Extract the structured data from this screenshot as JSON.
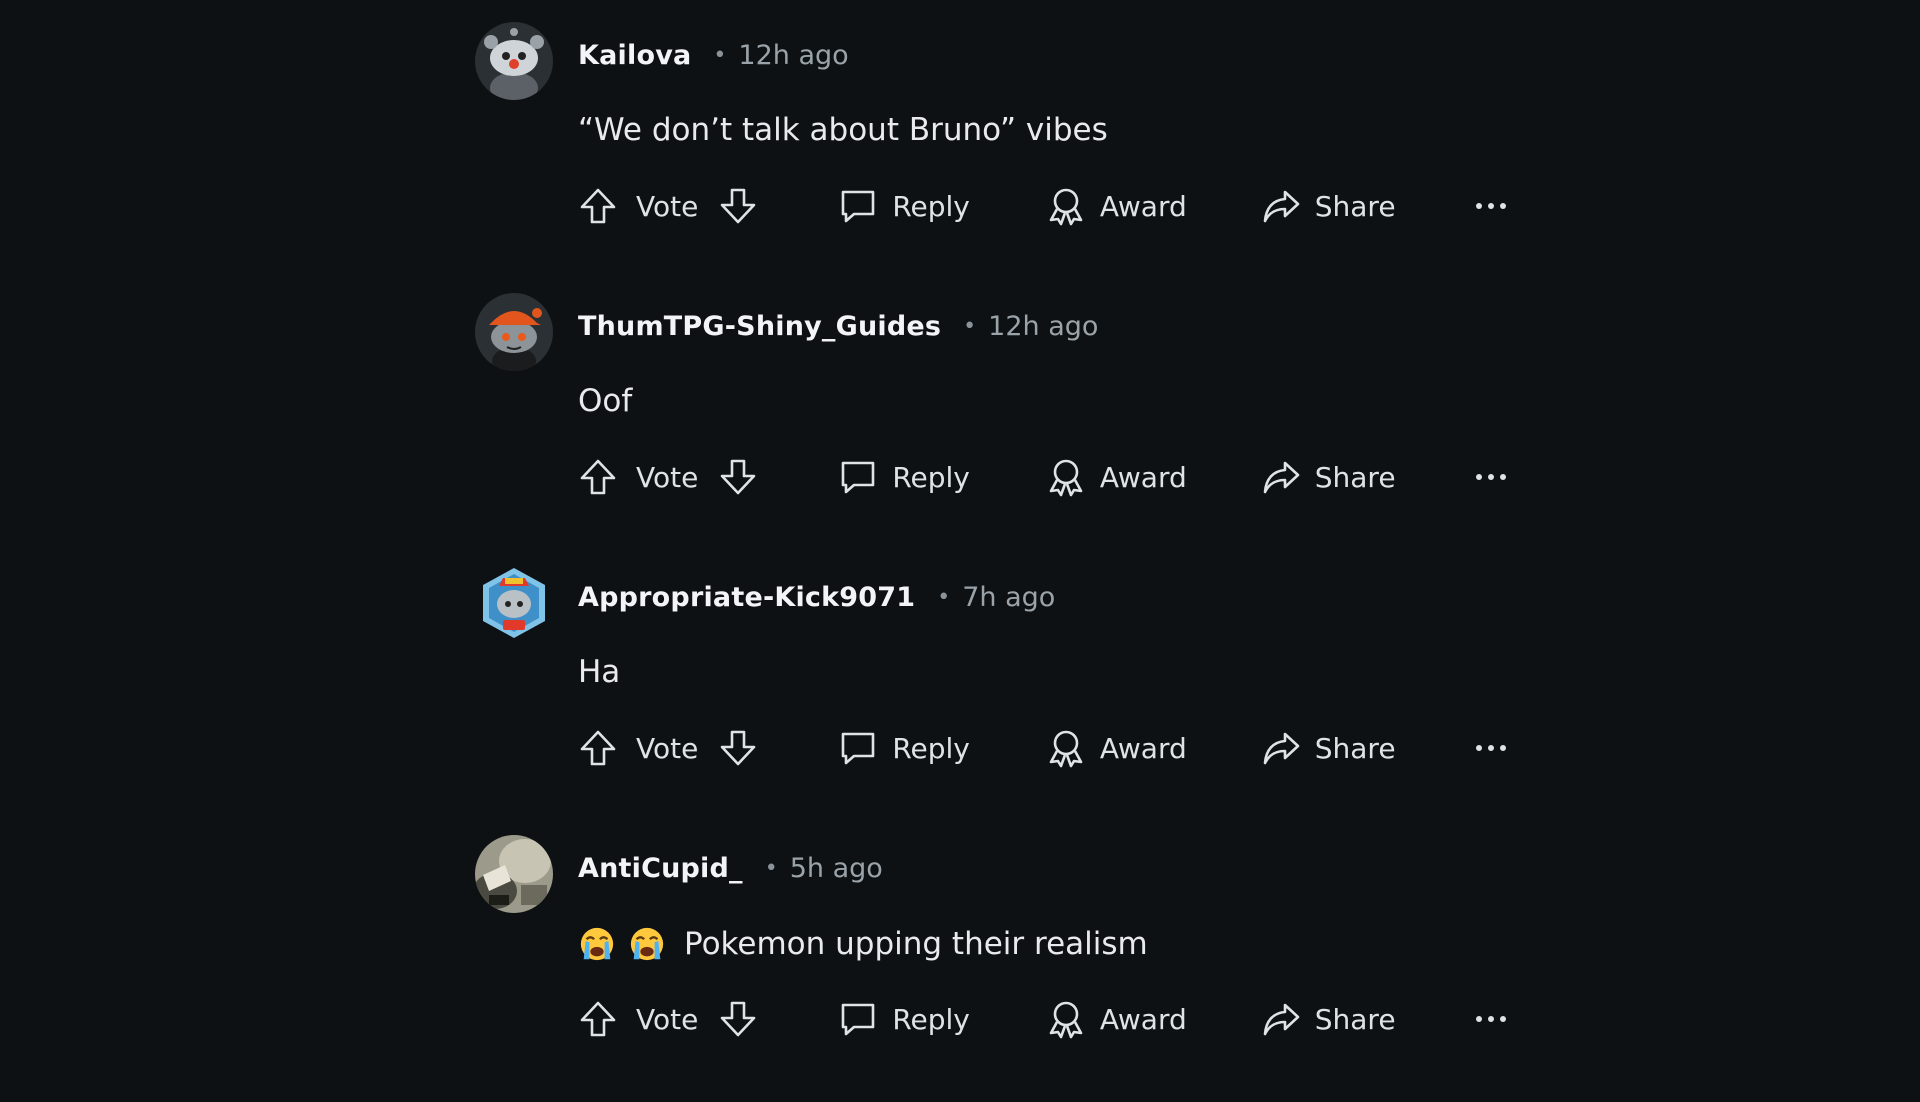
{
  "actions": {
    "vote": "Vote",
    "reply": "Reply",
    "award": "Award",
    "share": "Share"
  },
  "comments": [
    {
      "username": "Kailova",
      "time": "12h ago",
      "text": "“We don’t talk about Bruno” vibes",
      "avatar": "gray-snoo-avatar"
    },
    {
      "username": "ThumTPG-Shiny_Guides",
      "time": "12h ago",
      "text": "Oof",
      "avatar": "snoo-orange-cap-avatar"
    },
    {
      "username": "Appropriate-Kick9071",
      "time": "7h ago",
      "text": "Ha",
      "avatar": "snoo-hexagon-badge-avatar"
    },
    {
      "username": "AntiCupid_",
      "time": "5h ago",
      "text": "Pokemon upping their realism",
      "emojis": [
        "loudly-crying-face",
        "loudly-crying-face"
      ],
      "avatar": "photo-avatar"
    }
  ],
  "colors": {
    "background": "#0e1113",
    "text": "#e6e8ea",
    "muted": "#9aa3a9"
  }
}
